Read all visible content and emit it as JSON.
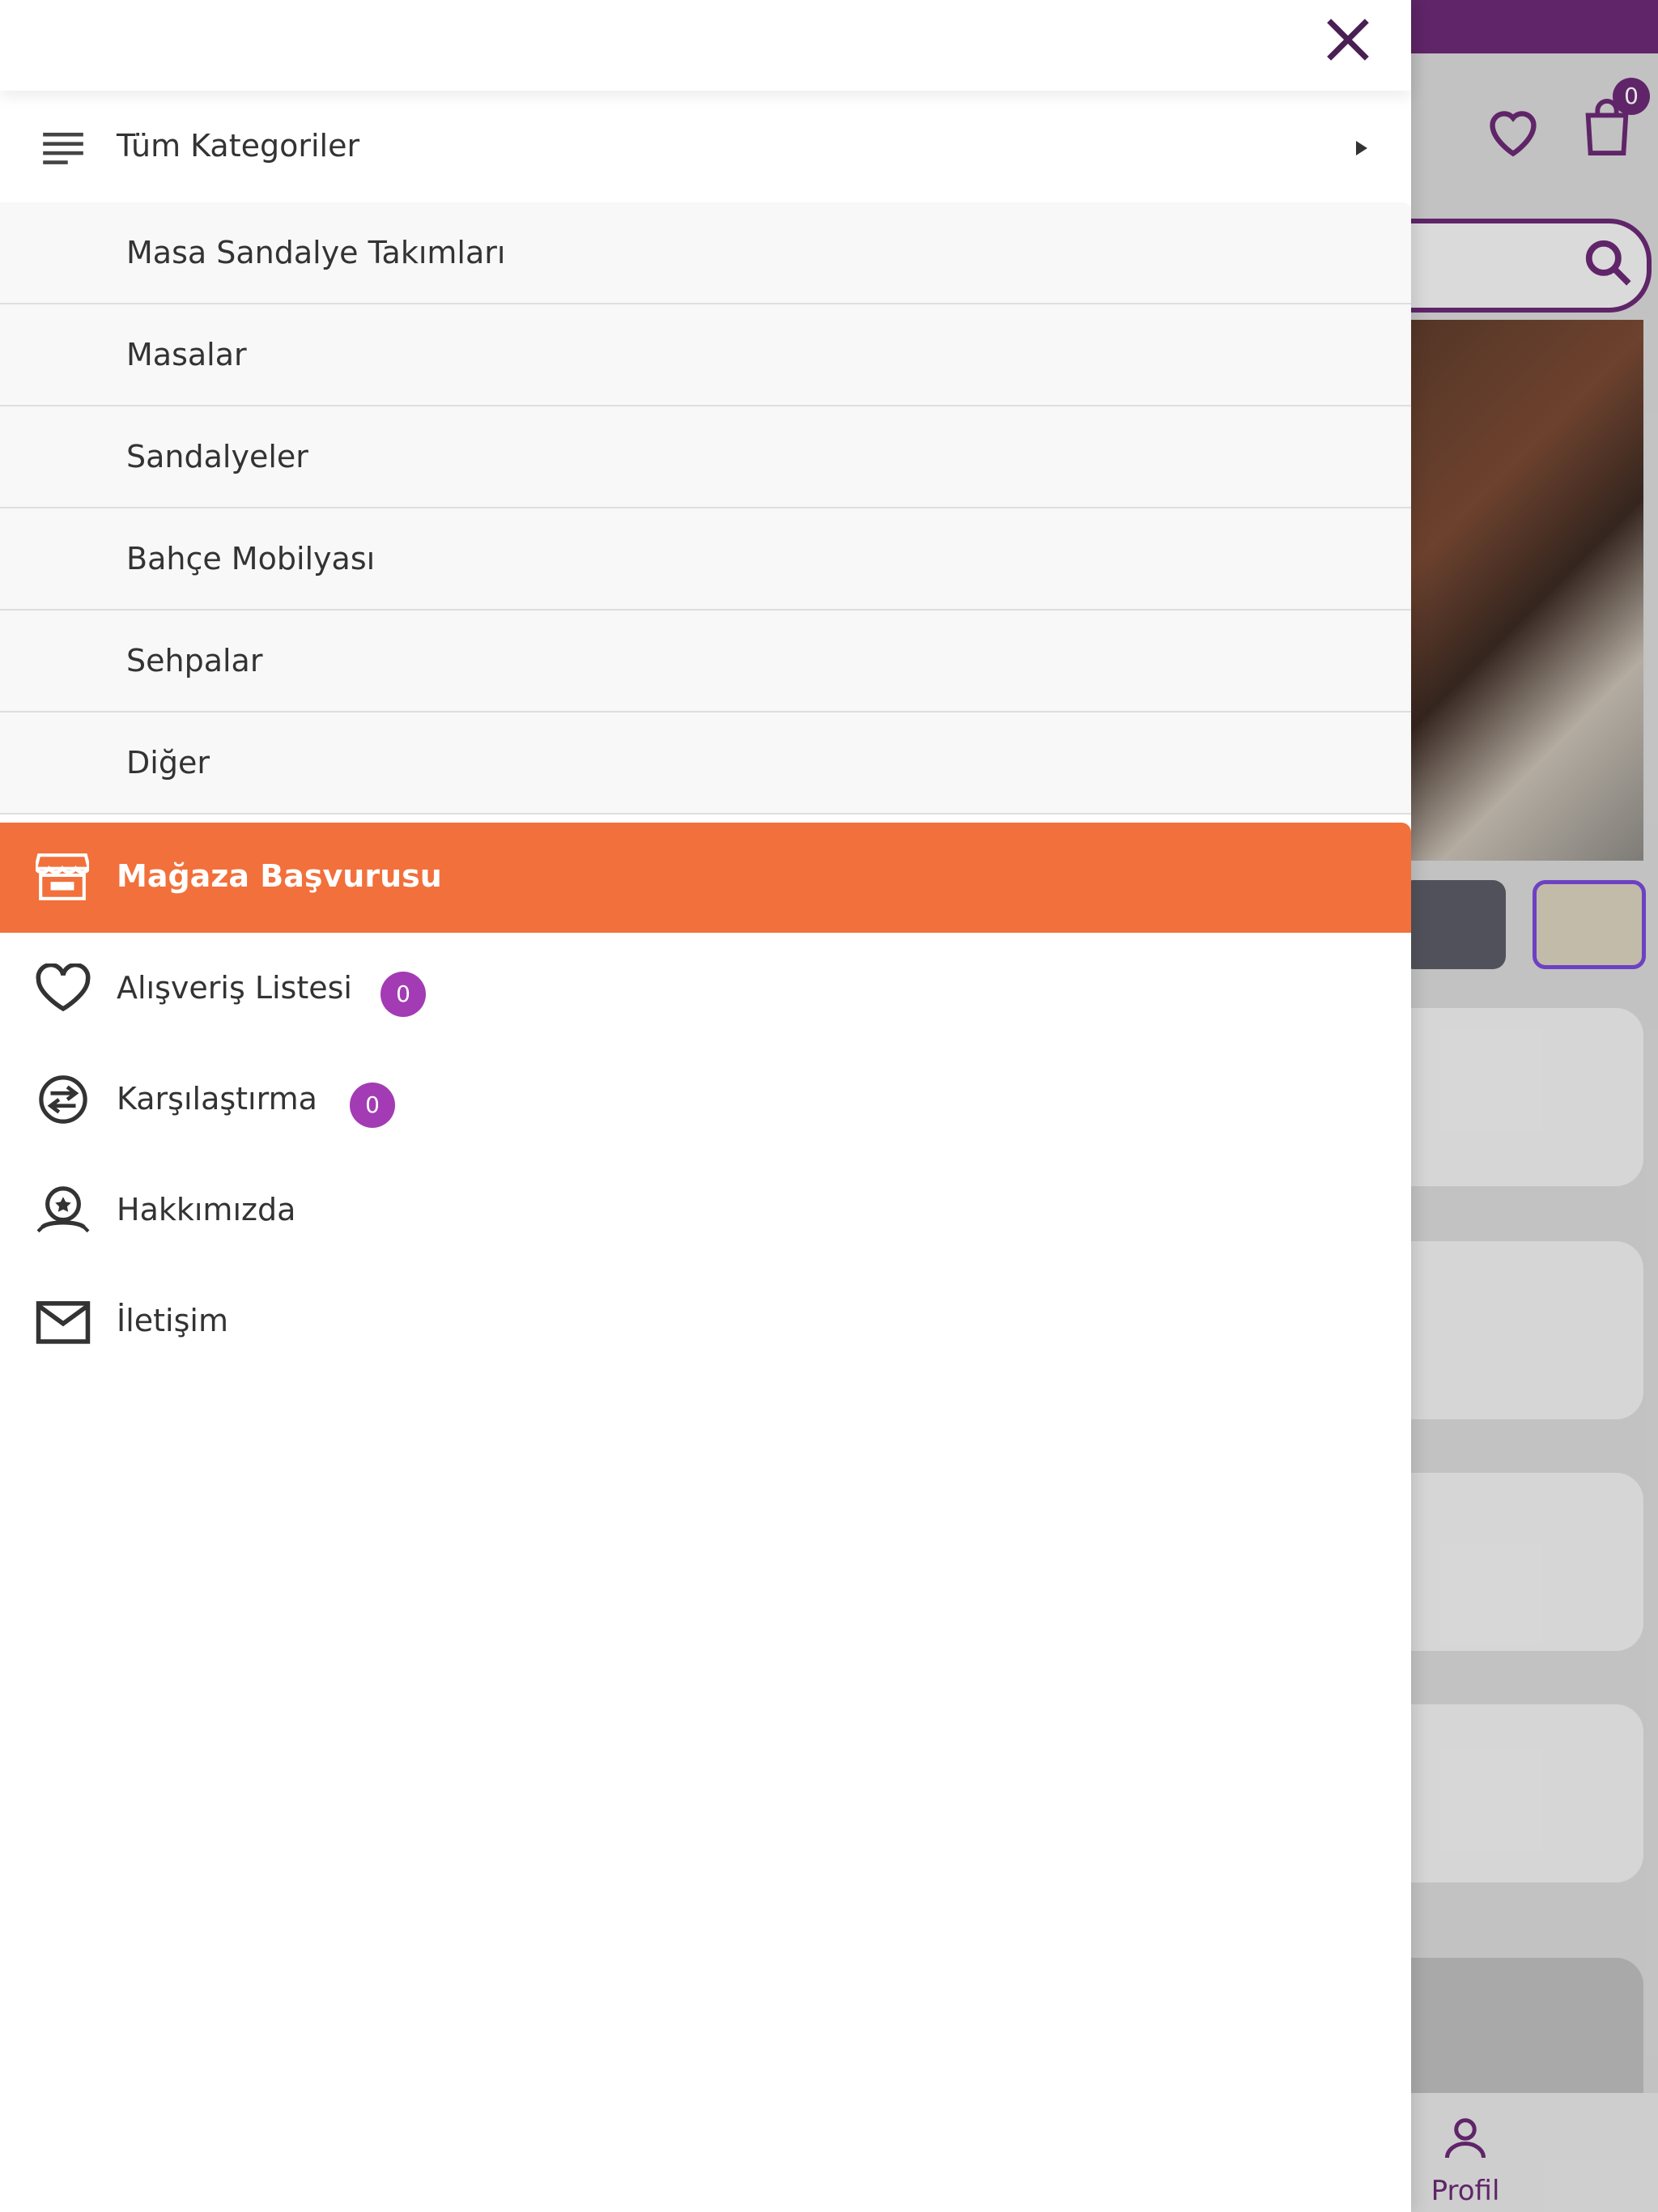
{
  "background": {
    "cart_count": "0",
    "bottom_nav_profile": "Profil"
  },
  "drawer": {
    "all_categories": "Tüm Kategoriler",
    "subcategories": [
      "Masa Sandalye Takımları",
      "Masalar",
      "Sandalyeler",
      "Bahçe Mobilyası",
      "Sehpalar",
      "Diğer"
    ],
    "store_apply": "Mağaza Başvurusu",
    "menu": {
      "shopping_list": {
        "label": "Alışveriş Listesi",
        "count": "0"
      },
      "compare": {
        "label": "Karşılaştırma",
        "count": "0"
      },
      "about": {
        "label": "Hakkımızda"
      },
      "contact": {
        "label": "İletişim"
      }
    }
  },
  "colors": {
    "brand_purple": "#6a2a74",
    "badge_purple": "#a33bb4",
    "accent_orange": "#f2703b",
    "icons": [
      "close-icon",
      "lines-icon",
      "caret-right-icon",
      "store-icon",
      "heart-icon",
      "compare-icon",
      "about-icon",
      "mail-icon",
      "search-icon",
      "bag-icon",
      "profile-icon"
    ]
  }
}
